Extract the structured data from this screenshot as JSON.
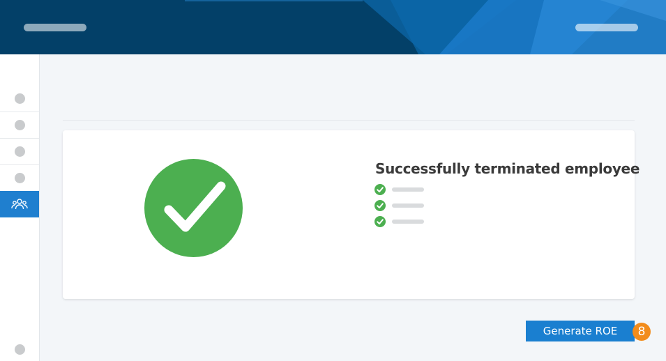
{
  "header": {
    "left_placeholder": "",
    "right_placeholder": ""
  },
  "sidebar": {
    "items": [
      {
        "icon": "circle-icon",
        "active": false
      },
      {
        "icon": "circle-icon",
        "active": false
      },
      {
        "icon": "circle-icon",
        "active": false
      },
      {
        "icon": "circle-icon",
        "active": false
      },
      {
        "icon": "people-icon",
        "active": true
      },
      {
        "icon": "circle-icon",
        "active": false
      }
    ]
  },
  "result": {
    "title": "Successfully terminated employee",
    "checklist_count": 3
  },
  "actions": {
    "generate_roe_label": "Generate ROE",
    "step_number": "8"
  },
  "colors": {
    "header": "#034068",
    "accent": "#1f7fcf",
    "success": "#4caf50",
    "badge": "#f28c1c"
  }
}
